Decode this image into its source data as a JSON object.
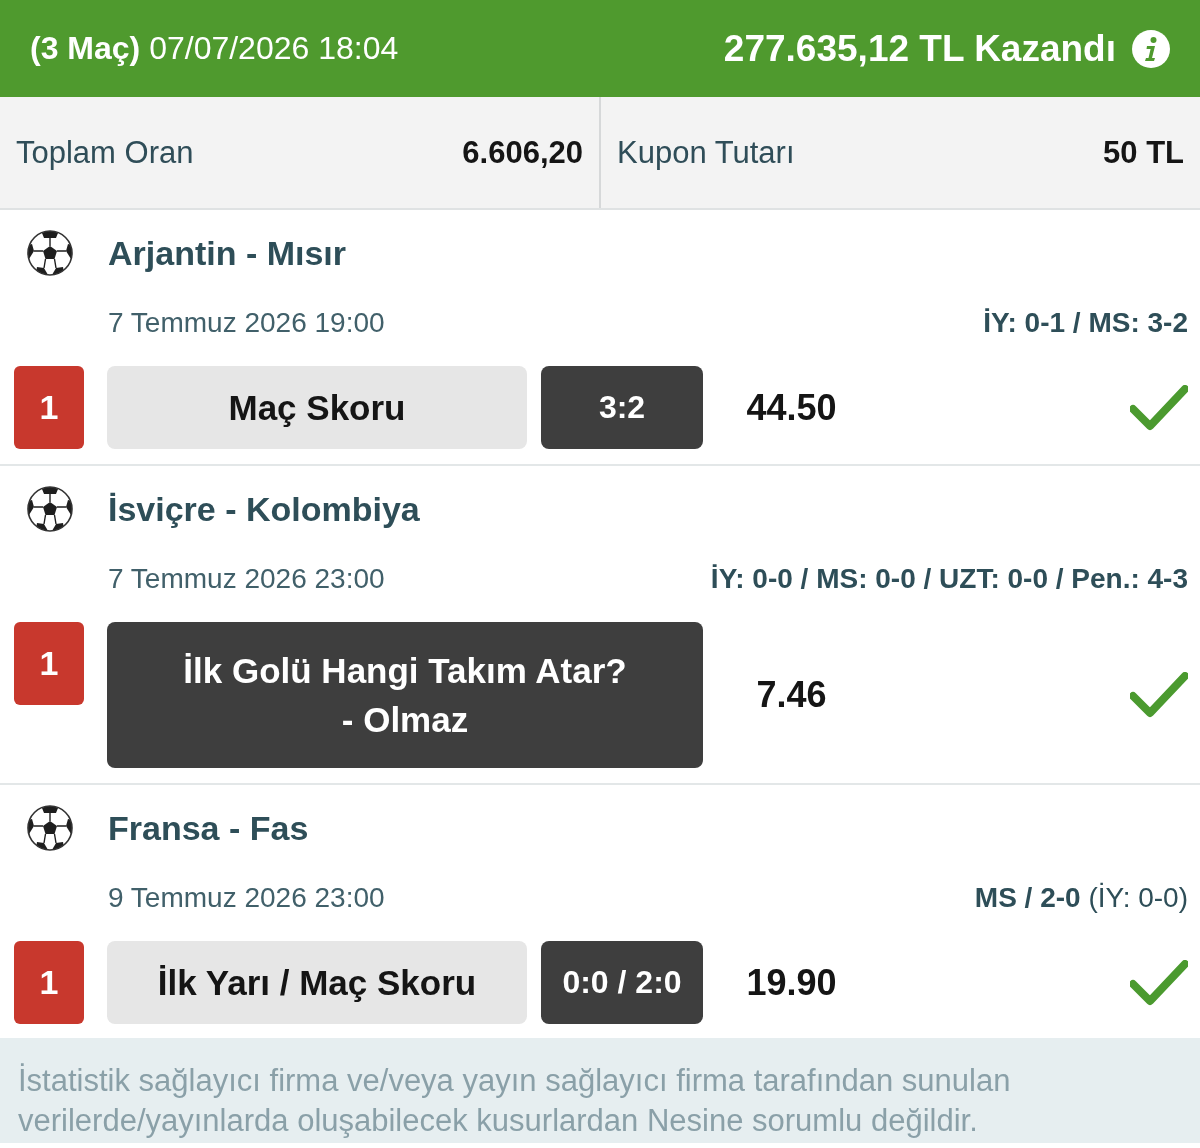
{
  "header": {
    "coupon_info": "**(3 Maç)** 07/07/2026 18:04",
    "winnings": "277.635,12 TL Kazandı"
  },
  "summary": [
    {
      "label": "Toplam Oran",
      "value": "6.606,20"
    },
    {
      "label": "Kupon Tutarı",
      "value": "50 TL"
    }
  ],
  "matches": [
    {
      "teams": "Arjantin - Mısır",
      "date": "7 Temmuz 2026 19:00",
      "result": "**İY: 0-1 / MS: 3-2**",
      "badge": "1",
      "kind": "split",
      "market": "Maç Skoru",
      "pick": "3:2",
      "odds": "44.50",
      "won": true
    },
    {
      "teams": "İsviçre - Kolombiya",
      "date": "7 Temmuz 2026 23:00",
      "result": "**İY: 0-0 / MS: 0-0 / UZT: 0-0 / Pen.: 4-3**",
      "badge": "1",
      "kind": "combined",
      "selection": "İlk Golü Hangi Takım Atar?\n- Olmaz",
      "odds": "7.46",
      "won": true
    },
    {
      "teams": "Fransa - Fas",
      "date": "9 Temmuz 2026 23:00",
      "result": "**MS / 2-0** (İY: 0-0)",
      "badge": "1",
      "kind": "split",
      "market": "İlk Yarı / Maç Skoru",
      "pick": "0:0 / 2:0",
      "odds": "19.90",
      "won": true
    }
  ],
  "disclaimer": "İstatistik sağlayıcı firma ve/veya yayın sağlayıcı firma tarafından sunulan verilerde/yayınlarda oluşabilecek kusurlardan Nesine sorumlu değildir."
}
